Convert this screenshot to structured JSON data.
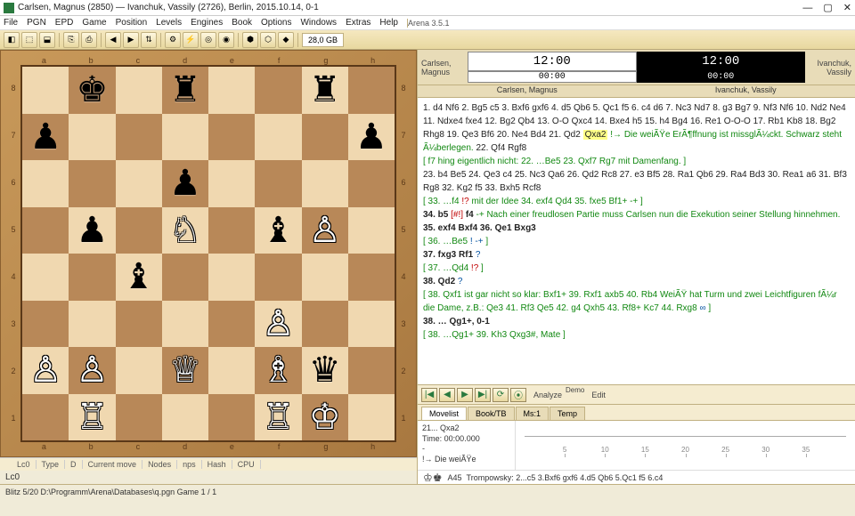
{
  "window": {
    "title": "Carlsen, Magnus (2850)  —  Ivanchuk, Vassily (2726),   Berlin,   2015.10.14,   0-1",
    "app_badge": "Arena 3.5.1"
  },
  "menu": [
    "File",
    "PGN",
    "EPD",
    "Game",
    "Position",
    "Levels",
    "Engines",
    "Book",
    "Options",
    "Windows",
    "Extras",
    "Help"
  ],
  "toolbar_value": "28,0 GB",
  "clocks": {
    "white": {
      "name": "Carlsen, Magnus",
      "main": "12:00",
      "sub": "00:00",
      "name_below": "Carlsen, Magnus"
    },
    "black": {
      "name": "Ivanchuk, Vassily",
      "main": "12:00",
      "sub": "00:00",
      "name_below": "Ivanchuk, Vassily"
    }
  },
  "board": {
    "files": [
      "a",
      "b",
      "c",
      "d",
      "e",
      "f",
      "g",
      "h"
    ],
    "ranks": [
      "8",
      "7",
      "6",
      "5",
      "4",
      "3",
      "2",
      "1"
    ],
    "pieces": [
      [
        "",
        "bK",
        "",
        "bR",
        "",
        "",
        "bR",
        ""
      ],
      [
        "bP",
        "",
        "",
        "",
        "",
        "",
        "",
        "bP"
      ],
      [
        "",
        "",
        "",
        "bP",
        "",
        "",
        "",
        ""
      ],
      [
        "",
        "bP",
        "",
        "wN",
        "",
        "bB",
        "wP",
        ""
      ],
      [
        "",
        "",
        "bB",
        "",
        "",
        "",
        "",
        ""
      ],
      [
        "",
        "",
        "",
        "",
        "",
        "wP",
        "",
        ""
      ],
      [
        "wP",
        "wP",
        "",
        "wQ",
        "",
        "wB",
        "bQ",
        ""
      ],
      [
        "",
        "wR",
        "",
        "",
        "",
        "wR",
        "wK",
        ""
      ]
    ]
  },
  "glyphs": {
    "K": "♔",
    "Q": "♕",
    "R": "♖",
    "B": "♗",
    "N": "♘",
    "P": "♙",
    "k": "♚",
    "q": "♛",
    "r": "♜",
    "b": "♝",
    "n": "♞",
    "p": "♟"
  },
  "engine_cols": [
    "",
    "Lc0",
    "Type",
    "D",
    "Current move",
    "Nodes",
    "nps",
    "Hash",
    "CPU"
  ],
  "engine_name": "Lc0",
  "moves_html": "1. d4 Nf6 2. Bg5 c5 3. Bxf6 gxf6 4. d5 Qb6 5. Qc1 f5 6. c4 d6 7. Nc3 Nd7 8. g3 Bg7 9. Nf3 Nf6 10. Nd2 Ne4 11. Ndxe4 fxe4 12. Bg2 Qb4 13. O-O Qxc4 14. Bxe4 h5 15. h4 Bg4 16. Re1 O-O-O 17. Rb1 Kb8 18. Bg2 Rhg8 19. Qe3 Bf6 20. Ne4 Bd4 21. Qd2 <span class='hl'>Qxa2</span> <span class='cm'>!→ Die weiÃŸe ErÃ¶ffnung ist missglÃ¼ckt. Schwarz steht Ã¼berlegen.</span> 22. Qf4 Rgf8<br><span class='cm'>[ f7 hing eigentlich nicht: 22. …Be5 23. Qxf7 Rg7 mit Damenfang. ]</span><br>23. b4 Be5 24. Qe3 c4 25. Nc3 Qa6 26. Qd2 Rc8 27. e3 Bf5 28. Ra1 Qb6 29. Ra4 Bd3 30. Rea1 a6 31. Bf3 Rg8 32. Kg2 f5 33. Bxh5 Rcf8<br><span class='cm'>[ 33. …f4 <span class='an'>!?</span> mit der Idee 34. exf4 Qd4 35. fxe5 Bf1+ -+ ]</span><br><b>34. b5</b> <span class='an'>[#!]</span> <b>f4</b> <span class='cm'>-+ Nach einer freudlosen Partie muss Carlsen nun die Exekution seiner Stellung hinnehmen.</span> <b>35. exf4 Bxf4 36. Qe1 Bxg3</b><br><span class='cm'>[ 36. …Be5 <span class='bl'>! -+</span> ]</span><br><b>37. fxg3 Rf1</b> <span class='bl'>?</span><br><span class='cm'>[ 37. …Qd4 <span class='an'>!?</span> ]</span><br><b>38. Qd2</b> <span class='bl'>?</span><br><span class='cm'>[ 38. Qxf1 ist gar nicht so klar: Bxf1+ 39. Rxf1 axb5 40. Rb4 WeiÃŸ hat Turm und zwei Leichtfiguren fÃ¼r die Dame, z.B.: Qe3 41. Rf3 Qe5 42. g4 Qxh5 43. Rf8+ Kc7 44. Rxg8 <span class='bl'>∞</span> ]</span><br><b>38. … Qg1+, 0-1</b><br><span class='cm'>[ 38. …Qg1+ 39. Kh3 Qxg3#, Mate ]</span>",
  "ctrl_labels": {
    "analyze": "Analyze",
    "demo": "Demo",
    "edit": "Edit"
  },
  "tabs": [
    "Movelist",
    "Book/TB",
    "Ms:1",
    "Temp"
  ],
  "info": {
    "move": "21... Qxa2",
    "time": "Time: 00:00.000",
    "extra": "!→ Die weiÃŸe"
  },
  "ruler_ticks": [
    "5",
    "10",
    "15",
    "20",
    "25",
    "30",
    "35"
  ],
  "eco": {
    "code": "A45",
    "name": "Trompowsky: 2...c5 3.Bxf6 gxf6 4.d5 Qb6 5.Qc1 f5 6.c4"
  },
  "status": "Blitz 5/20   D:\\Programm\\Arena\\Databases\\q.pgn  Game 1 / 1"
}
